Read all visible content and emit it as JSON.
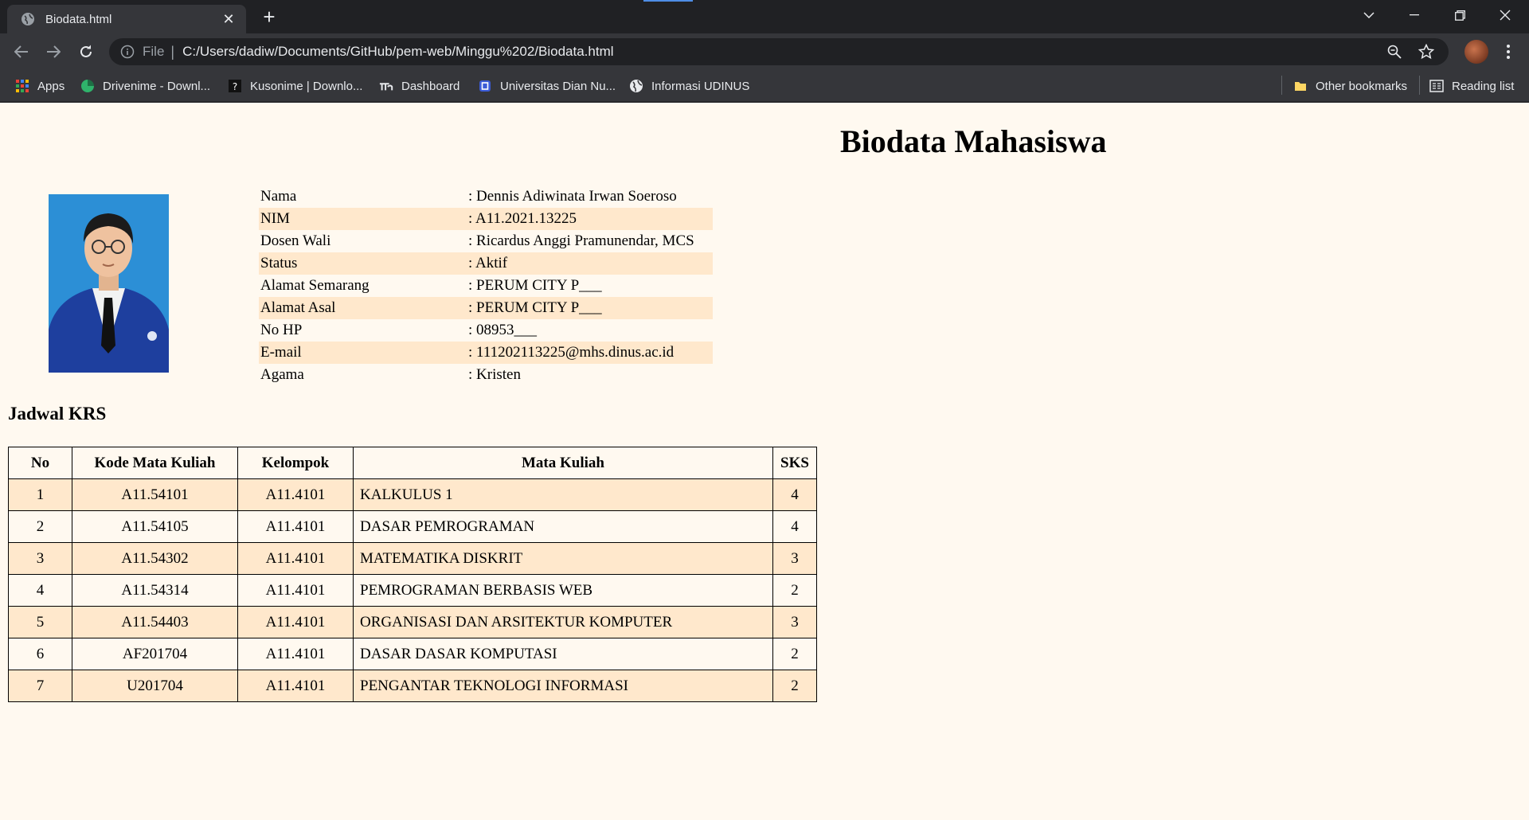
{
  "browser": {
    "tab_title": "Biodata.html",
    "address_scheme": "File",
    "address_url": "C:/Users/dadiw/Documents/GitHub/pem-web/Minggu%202/Biodata.html",
    "bookmarks": [
      {
        "label": "Apps",
        "icon": "apps-grid-icon"
      },
      {
        "label": "Drivenime - Downl...",
        "icon": "drivenime-icon"
      },
      {
        "label": "Kusonime | Downlo...",
        "icon": "kusonime-icon"
      },
      {
        "label": "Dashboard",
        "icon": "dashboard-icon"
      },
      {
        "label": "Universitas Dian Nu...",
        "icon": "udinus-icon"
      },
      {
        "label": "Informasi UDINUS",
        "icon": "globe-icon"
      }
    ],
    "other_bookmarks": "Other bookmarks",
    "reading_list": "Reading list"
  },
  "page": {
    "title": "Biodata Mahasiswa",
    "biodata": [
      {
        "label": "Nama",
        "value": ": Dennis Adiwinata Irwan Soeroso"
      },
      {
        "label": "NIM",
        "value": ": A11.2021.13225"
      },
      {
        "label": "Dosen Wali",
        "value": ": Ricardus Anggi Pramunendar, MCS"
      },
      {
        "label": "Status",
        "value": ": Aktif"
      },
      {
        "label": "Alamat Semarang",
        "value": ": PERUM CITY P___"
      },
      {
        "label": "Alamat Asal",
        "value": ": PERUM CITY P___"
      },
      {
        "label": "No HP",
        "value": ": 08953___"
      },
      {
        "label": "E-mail",
        "value": ": 111202113225@mhs.dinus.ac.id"
      },
      {
        "label": "Agama",
        "value": ": Kristen"
      }
    ],
    "krs_heading": "Jadwal KRS",
    "krs_headers": [
      "No",
      "Kode Mata Kuliah",
      "Kelompok",
      "Mata Kuliah",
      "SKS"
    ],
    "krs_rows": [
      [
        "1",
        "A11.54101",
        "A11.4101",
        "KALKULUS 1",
        "4"
      ],
      [
        "2",
        "A11.54105",
        "A11.4101",
        "DASAR PEMROGRAMAN",
        "4"
      ],
      [
        "3",
        "A11.54302",
        "A11.4101",
        "MATEMATIKA DISKRIT",
        "3"
      ],
      [
        "4",
        "A11.54314",
        "A11.4101",
        "PEMROGRAMAN BERBASIS WEB",
        "2"
      ],
      [
        "5",
        "A11.54403",
        "A11.4101",
        "ORGANISASI DAN ARSITEKTUR KOMPUTER",
        "3"
      ],
      [
        "6",
        "AF201704",
        "A11.4101",
        "DASAR DASAR KOMPUTASI",
        "2"
      ],
      [
        "7",
        "U201704",
        "A11.4101",
        "PENGANTAR TEKNOLOGI INFORMASI",
        "2"
      ]
    ]
  },
  "colors": {
    "page_background": "#fff9f0",
    "stripe": "#ffe8cc",
    "photo_background": "#2c8fd6"
  }
}
